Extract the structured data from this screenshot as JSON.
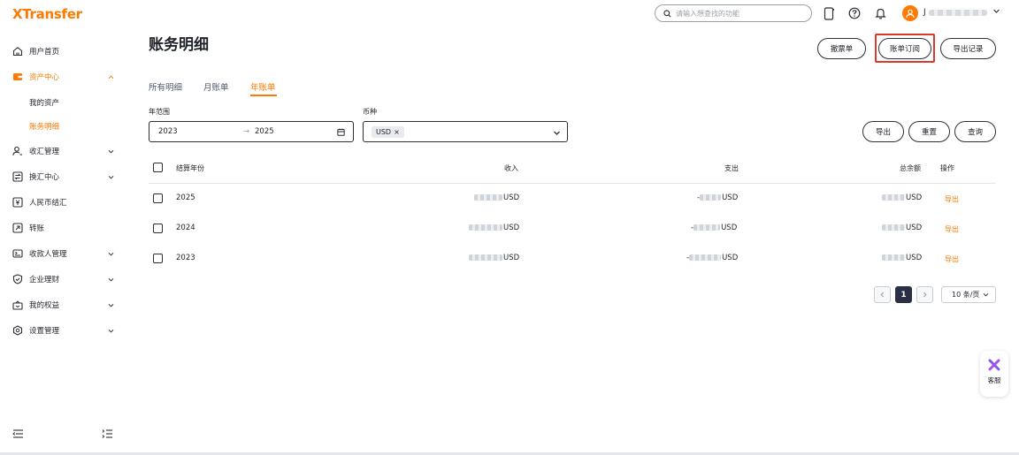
{
  "app": {
    "logo": "XTransfer",
    "brand_color": "#ff7a00"
  },
  "header": {
    "search_placeholder": "请输入想查找的功能",
    "username": "J",
    "icons": [
      "document-icon",
      "help-icon",
      "bell-icon",
      "user-avatar-icon",
      "chevron-down-icon"
    ]
  },
  "sidebar": {
    "items": [
      {
        "label": "用户首页",
        "icon": "home-icon"
      },
      {
        "label": "资产中心",
        "icon": "wallet-icon",
        "expanded": true,
        "active": true
      },
      {
        "label": "收汇管理",
        "icon": "person-icon"
      },
      {
        "label": "换汇中心",
        "icon": "exchange-icon"
      },
      {
        "label": "人民币结汇",
        "icon": "settlement-icon"
      },
      {
        "label": "转账",
        "icon": "transfer-icon"
      },
      {
        "label": "收款人管理",
        "icon": "payee-icon"
      },
      {
        "label": "企业理财",
        "icon": "shield-icon"
      },
      {
        "label": "我的权益",
        "icon": "gift-icon"
      },
      {
        "label": "设置管理",
        "icon": "settings-icon"
      }
    ],
    "sub_items": [
      {
        "label": "我的资产"
      },
      {
        "label": "账务明细",
        "active": true
      }
    ]
  },
  "page": {
    "title": "账务明细",
    "actions": {
      "receipt": "撤票单",
      "subscribe": "账单订阅",
      "export_records": "导出记录"
    },
    "tabs": [
      "所有明细",
      "月账单",
      "年账单"
    ],
    "active_tab": "年账单",
    "filters": {
      "year_range_label": "年范围",
      "year_start": "2023",
      "year_end": "2025",
      "currency_label": "币种",
      "currency_tag": "USD"
    },
    "filter_buttons": {
      "export": "导出",
      "reset": "重置",
      "query": "查询"
    },
    "table": {
      "headers": {
        "year": "结算年份",
        "income": "收入",
        "expense": "支出",
        "balance": "总余额",
        "action": "操作"
      },
      "rows": [
        {
          "year": "2025",
          "income": "USD",
          "expense": "-",
          "expense_suffix": "USD",
          "balance": "USD",
          "action": "导出"
        },
        {
          "year": "2024",
          "income": "USD",
          "expense": "-",
          "expense_suffix": "USD",
          "balance": "USD",
          "action": "导出"
        },
        {
          "year": "2023",
          "income": "USD",
          "expense": "-",
          "expense_suffix": "USD",
          "balance": "USD",
          "action": "导出"
        }
      ]
    },
    "pagination": {
      "current_page": "1",
      "page_size": "10 条/页"
    }
  },
  "service_widget": {
    "label": "客服"
  }
}
